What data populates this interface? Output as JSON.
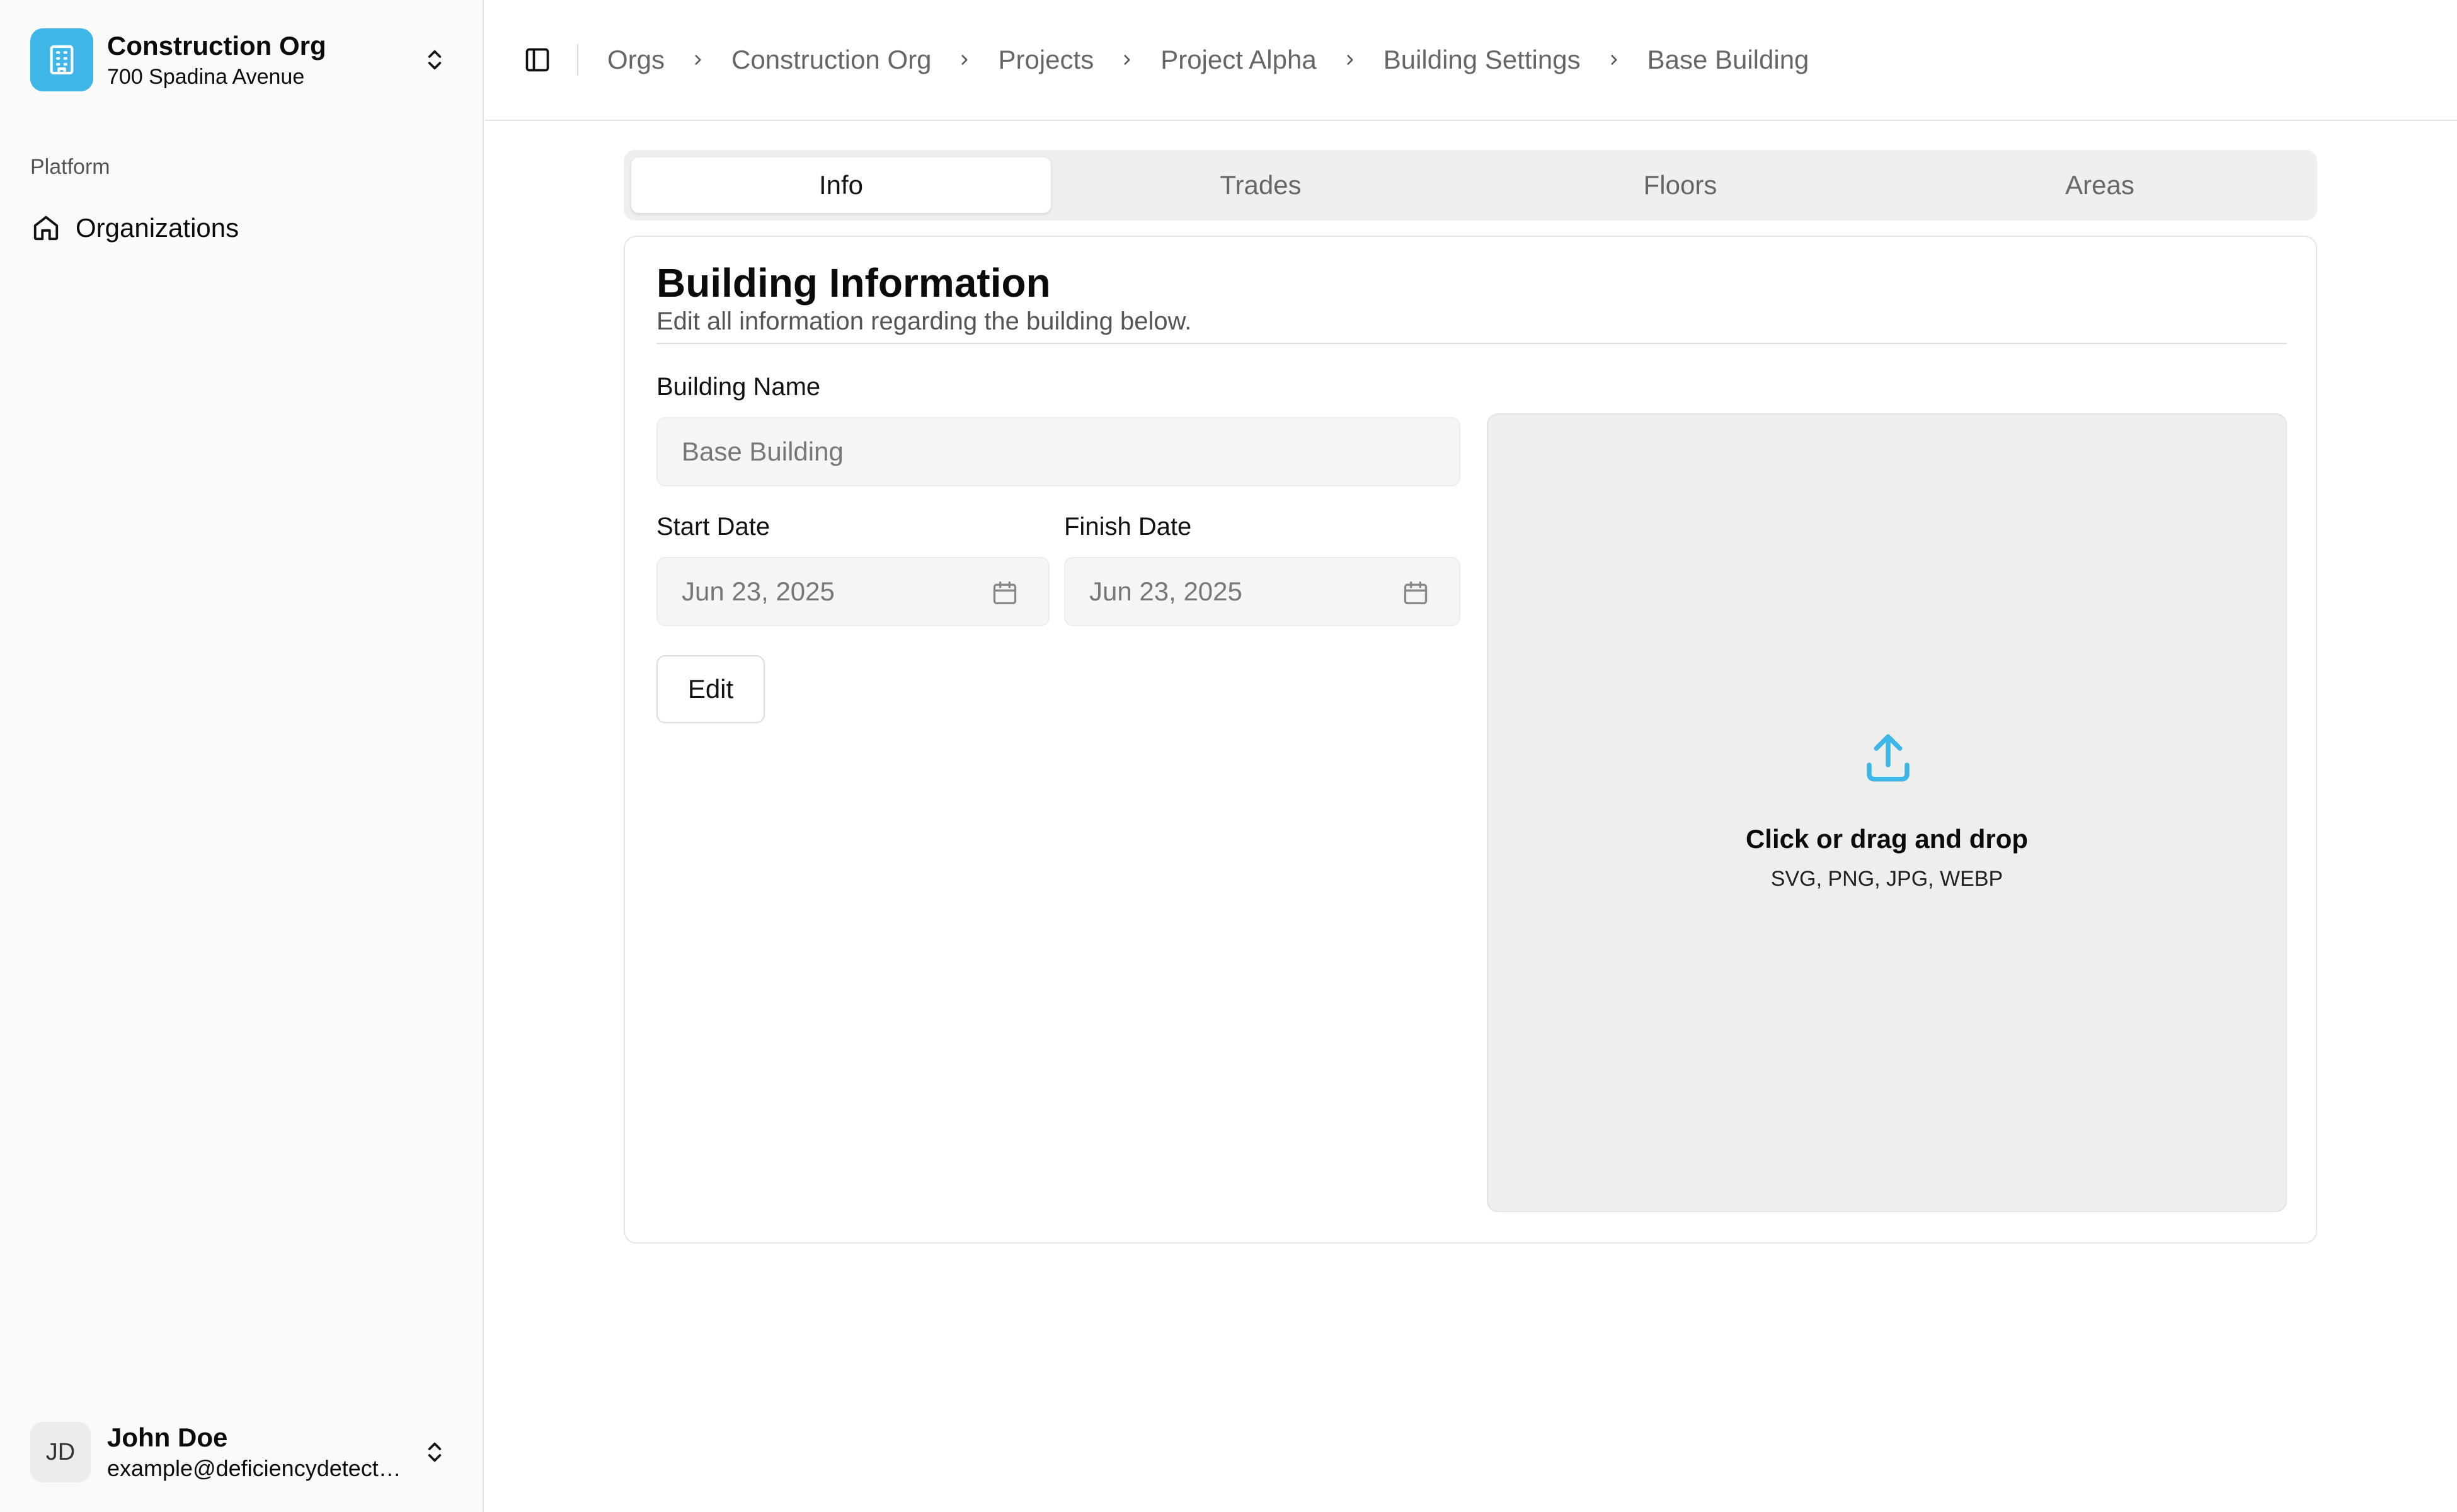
{
  "sidebar": {
    "org": {
      "name": "Construction Org",
      "address": "700 Spadina Avenue"
    },
    "section_label": "Platform",
    "items": [
      {
        "label": "Organizations",
        "icon": "home-icon"
      }
    ],
    "user": {
      "initials": "JD",
      "name": "John Doe",
      "email": "example@deficiencydetect...."
    }
  },
  "header": {
    "breadcrumb": [
      "Orgs",
      "Construction Org",
      "Projects",
      "Project Alpha",
      "Building Settings",
      "Base Building"
    ]
  },
  "tabs": [
    {
      "label": "Info",
      "active": true
    },
    {
      "label": "Trades",
      "active": false
    },
    {
      "label": "Floors",
      "active": false
    },
    {
      "label": "Areas",
      "active": false
    }
  ],
  "card": {
    "title": "Building Information",
    "description": "Edit all information regarding the building below.",
    "building_name_label": "Building Name",
    "building_name_value": "Base Building",
    "start_date_label": "Start Date",
    "start_date_value": "Jun 23, 2025",
    "finish_date_label": "Finish Date",
    "finish_date_value": "Jun 23, 2025",
    "edit_label": "Edit",
    "dropzone_title": "Click or drag and drop",
    "dropzone_formats": "SVG, PNG, JPG, WEBP"
  },
  "colors": {
    "accent": "#3fb6e8",
    "sidebar_bg": "#fafafa",
    "input_bg": "#f5f5f4",
    "dropzone_bg": "#eeeeed"
  }
}
